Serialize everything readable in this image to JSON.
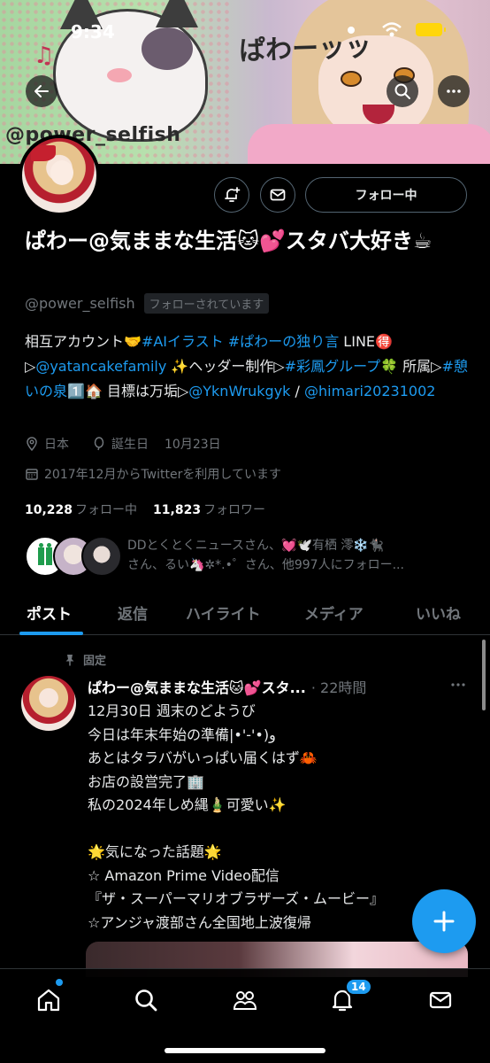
{
  "status_bar": {
    "time": "9:34"
  },
  "banner": {
    "script_title": "ぱわーッッ",
    "overlay_handle": "@power_selfish"
  },
  "profile": {
    "name": "ぱわー@気ままな生活🐱💕スタバ大好き☕",
    "handle": "@power_selfish",
    "follows_you_label": "フォローされています",
    "follow_button_label": "フォロー中",
    "bio": {
      "t1": "相互アカウント🤝",
      "l1": "#AIイラスト",
      "t2": " ",
      "l2": "#ぱわーの独り言",
      "t3": " LINE🉐▷",
      "l3": "@yatancakefamily",
      "t4": " ✨ヘッダー制作▷",
      "l4": "#彩鳳グループ",
      "t5": "🍀 所属▷",
      "l5": "#憩いの泉",
      "t6": "1️⃣🏠 目標は万垢▷",
      "l6": "@YknWrukgyk",
      "t7": " / ",
      "l7": "@himari20231002"
    },
    "location": "日本",
    "birthday_label": "誕生日",
    "birthday": "10月23日",
    "joined": "2017年12月からTwitterを利用しています",
    "following_count": "10,228",
    "following_label": "フォロー中",
    "followers_count": "11,823",
    "followers_label": "フォロワー",
    "followed_by_line1": "DDとくとくニュースさん、💓🕊️有栖 澪❄️🐈‍⬛",
    "followed_by_line2": "さん、るい🦄✲*.•゜さん、他997人にフォロー..."
  },
  "tabs": [
    {
      "label": "ポスト",
      "active": true
    },
    {
      "label": "返信",
      "active": false
    },
    {
      "label": "ハイライト",
      "active": false
    },
    {
      "label": "メディア",
      "active": false
    },
    {
      "label": "いいね",
      "active": false
    }
  ],
  "post": {
    "pinned_label": "固定",
    "author": "ぱわー@気ままな生活🐱💕スタ...",
    "time": "· 22時間",
    "body": "12月30日 週末のどようび\n今日は年末年始の準備|•'-'•)و\nあとはタラバがいっぱい届くはず🦀\nお店の設営完了🏢\n私の2024年しめ縄🎍可愛い✨\n\n🌟気になった話題🌟\n☆ Amazon Prime Video配信\n『ザ・スーパーマリオブラザーズ・ムービー』\n☆アンジャ渡部さん全国地上波復帰"
  },
  "bottom_nav": {
    "notifications_badge": "14"
  },
  "colors": {
    "accent": "#1d9bf0",
    "background": "#000000",
    "muted": "#71767b",
    "battery": "#ffd60a"
  }
}
